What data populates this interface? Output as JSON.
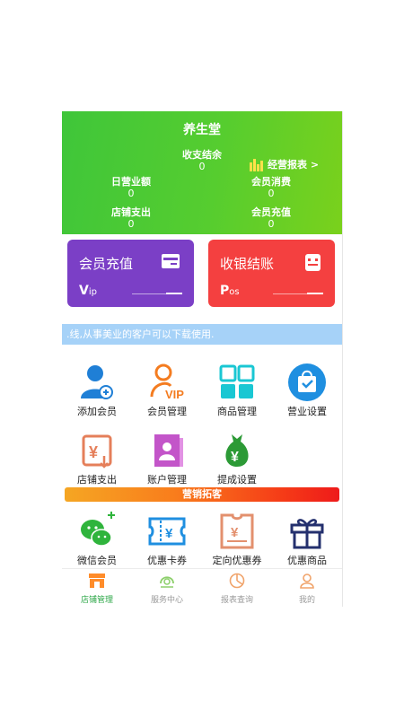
{
  "header": {
    "store_name": "养生堂",
    "cash_balance_label": "收支结余",
    "cash_balance_value": "0",
    "report_link": "经营报表 >",
    "daily_revenue_label": "日营业额",
    "daily_revenue_value": "0",
    "member_consumption_label": "会员消费",
    "member_consumption_value": "0",
    "store_expense_label": "店铺支出",
    "store_expense_value": "0",
    "member_recharge_label": "会员充值",
    "member_recharge_value": "0"
  },
  "cards": {
    "vip": {
      "title": "会员充值",
      "sub_big": "V",
      "sub_small": "ip",
      "color": "#7b3fc6"
    },
    "pos": {
      "title": "收银结账",
      "sub_big": "P",
      "sub_small": "os",
      "color": "#f44040"
    }
  },
  "banner_text": ".线,从事美业的客户可以下载使用.",
  "grid": {
    "add_member": "添加会员",
    "member_mgmt": "会员管理",
    "product_mgmt": "商品管理",
    "business_settings": "营业设置",
    "store_expense": "店铺支出",
    "account_mgmt": "账户管理",
    "commission_settings": "提成设置"
  },
  "marketing_title": "营销拓客",
  "marketing": {
    "wechat_member": "微信会员",
    "discount_card": "优惠卡券",
    "targeted_coupon": "定向优惠券",
    "discount_product": "优惠商品"
  },
  "tabs": {
    "store": "店铺管理",
    "service": "服务中心",
    "report": "报表查询",
    "mine": "我的"
  },
  "colors": {
    "active_tab": "#ff8c2a",
    "green": "#4cc936",
    "purple_card": "#7b3fc6",
    "red_card": "#f44040"
  }
}
